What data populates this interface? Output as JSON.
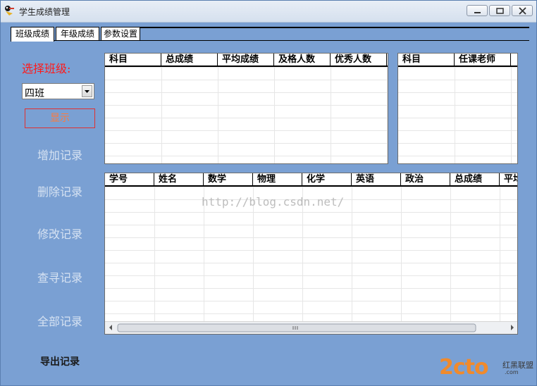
{
  "window": {
    "title": "学生成绩管理"
  },
  "tabs": [
    "班级成绩",
    "年级成绩",
    "参数设置"
  ],
  "left": {
    "label": "选择班级:",
    "class_select": {
      "value": "四班"
    },
    "show_button": "显示",
    "buttons": [
      "增加记录",
      "删除记录",
      "修改记录",
      "查寻记录",
      "全部记录",
      "导出记录"
    ]
  },
  "subject_stats": {
    "columns": [
      "科目",
      "总成绩",
      "平均成绩",
      "及格人数",
      "优秀人数"
    ]
  },
  "teachers": {
    "columns": [
      "科目",
      "任课老师"
    ]
  },
  "students": {
    "columns": [
      "学号",
      "姓名",
      "数学",
      "物理",
      "化学",
      "英语",
      "政治",
      "总成绩",
      "平均"
    ]
  },
  "watermark": "http://blog.csdn.net/",
  "logo": {
    "text": "2cto",
    "suffix": ".com",
    "sub": "红黑联盟"
  }
}
